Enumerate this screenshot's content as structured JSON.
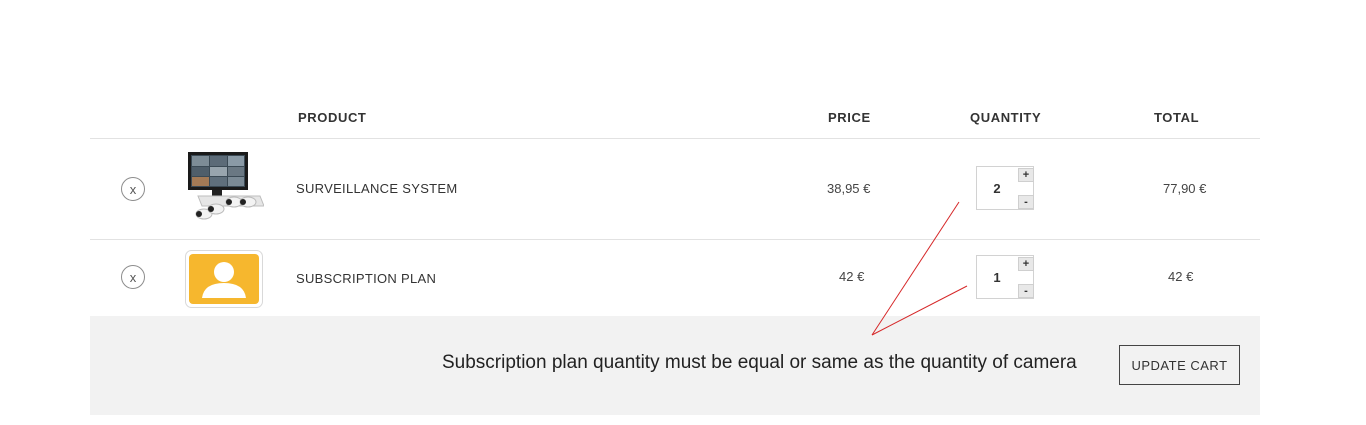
{
  "table": {
    "headers": {
      "product": "PRODUCT",
      "price": "PRICE",
      "quantity": "QUANTITY",
      "total": "TOTAL"
    }
  },
  "items": [
    {
      "remove": "x",
      "thumbnail_icon": "surveillance-system-icon",
      "name": "SURVEILLANCE SYSTEM",
      "price": "38,95 €",
      "quantity": "2",
      "plus": "+",
      "minus": "-",
      "total": "77,90 €"
    },
    {
      "remove": "x",
      "thumbnail_icon": "user-profile-icon",
      "name": "SUBSCRIPTION PLAN",
      "price": "42 €",
      "quantity": "1",
      "plus": "+",
      "minus": "-",
      "total": "42 €"
    }
  ],
  "footer": {
    "note": "Subscription plan quantity must be equal or same as the quantity of camera",
    "update_label": "UPDATE CART"
  },
  "colors": {
    "annotation": "#d62728",
    "footer_bg": "#f2f2f2",
    "thumb_yellow": "#f6b72e"
  }
}
